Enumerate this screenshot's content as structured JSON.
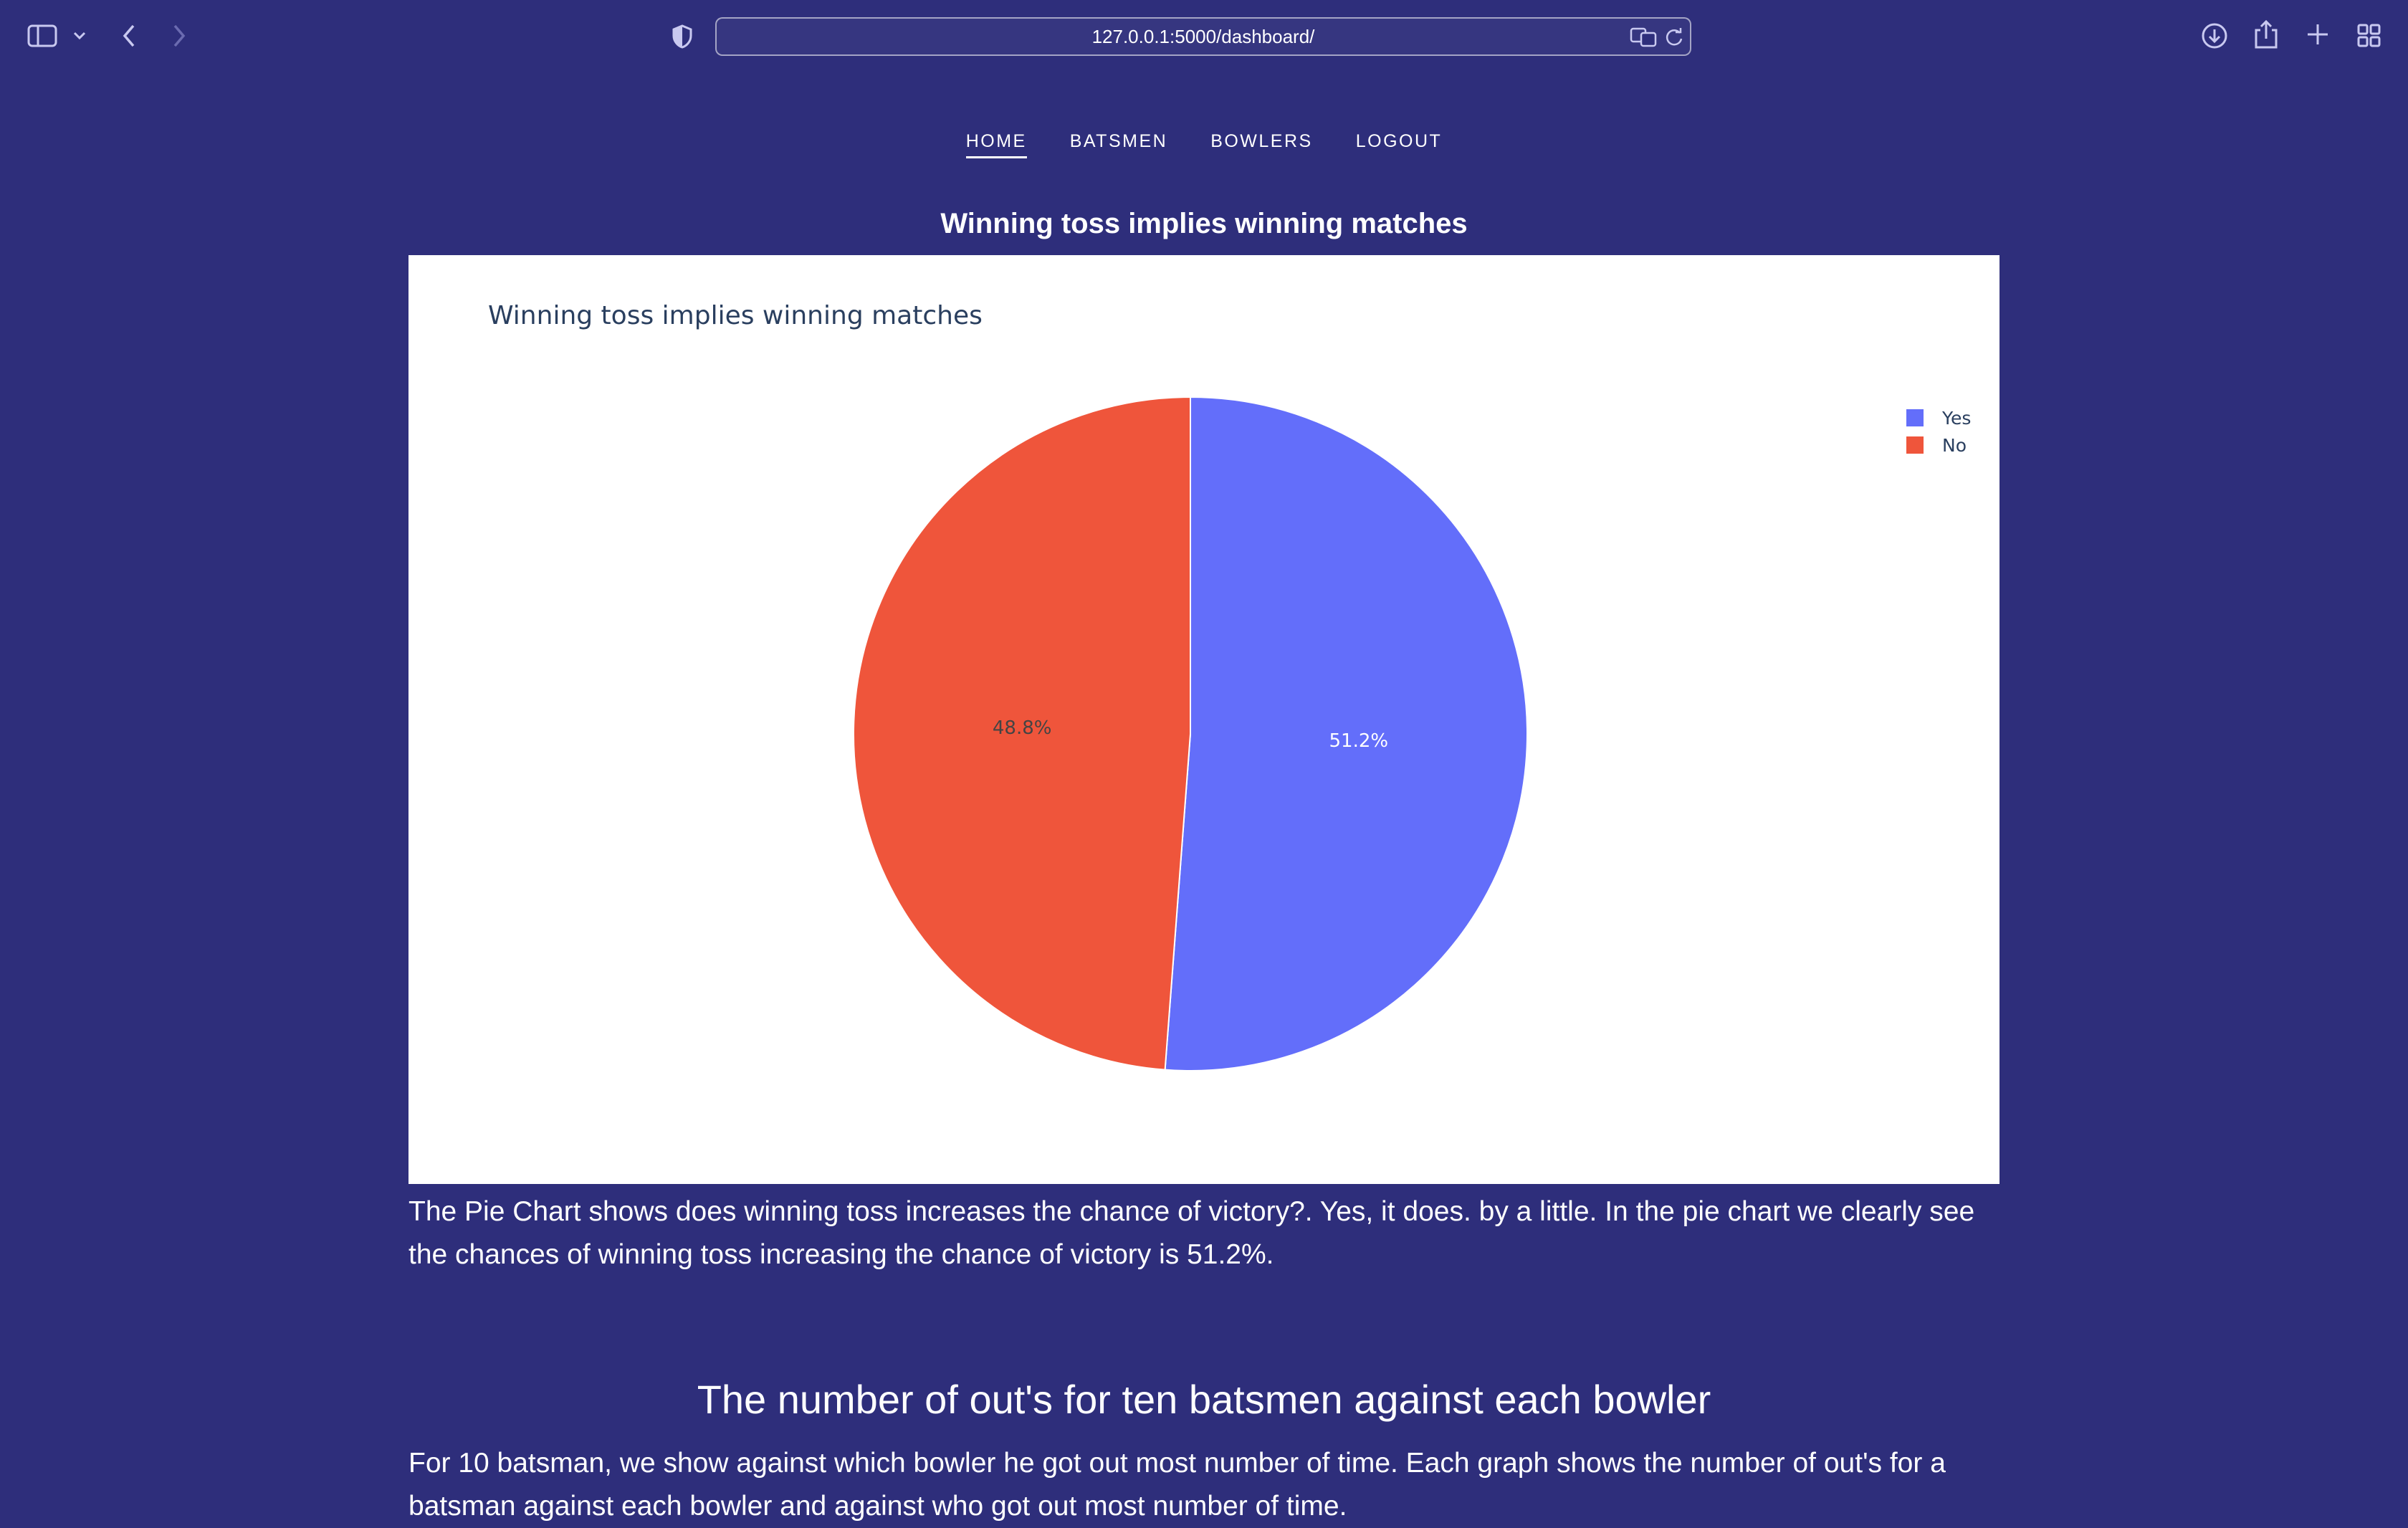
{
  "browser": {
    "url": "127.0.0.1:5000/dashboard/"
  },
  "nav": {
    "items": [
      {
        "label": "HOME",
        "active": true
      },
      {
        "label": "BATSMEN",
        "active": false
      },
      {
        "label": "BOWLERS",
        "active": false
      },
      {
        "label": "LOGOUT",
        "active": false
      }
    ]
  },
  "section1": {
    "title": "Winning toss implies winning matches",
    "description": "The Pie Chart shows does winning toss increases the chance of victory?. Yes, it does. by a little. In the pie chart we clearly see the chances of winning toss increasing the chance of victory is 51.2%."
  },
  "chart_data": {
    "type": "pie",
    "title": "Winning toss implies winning matches",
    "categories": [
      "Yes",
      "No"
    ],
    "values": [
      51.2,
      48.8
    ],
    "labels": [
      "51.2%",
      "48.8%"
    ],
    "colors": [
      "#636efa",
      "#ef553b"
    ],
    "legend": "top-right"
  },
  "section2": {
    "title": "The number of out's for ten batsmen against each bowler",
    "description": "For 10 batsman, we show against which bowler he got out most number of time. Each graph shows the number of out's for a batsman against each bowler and against who got out most number of time."
  }
}
